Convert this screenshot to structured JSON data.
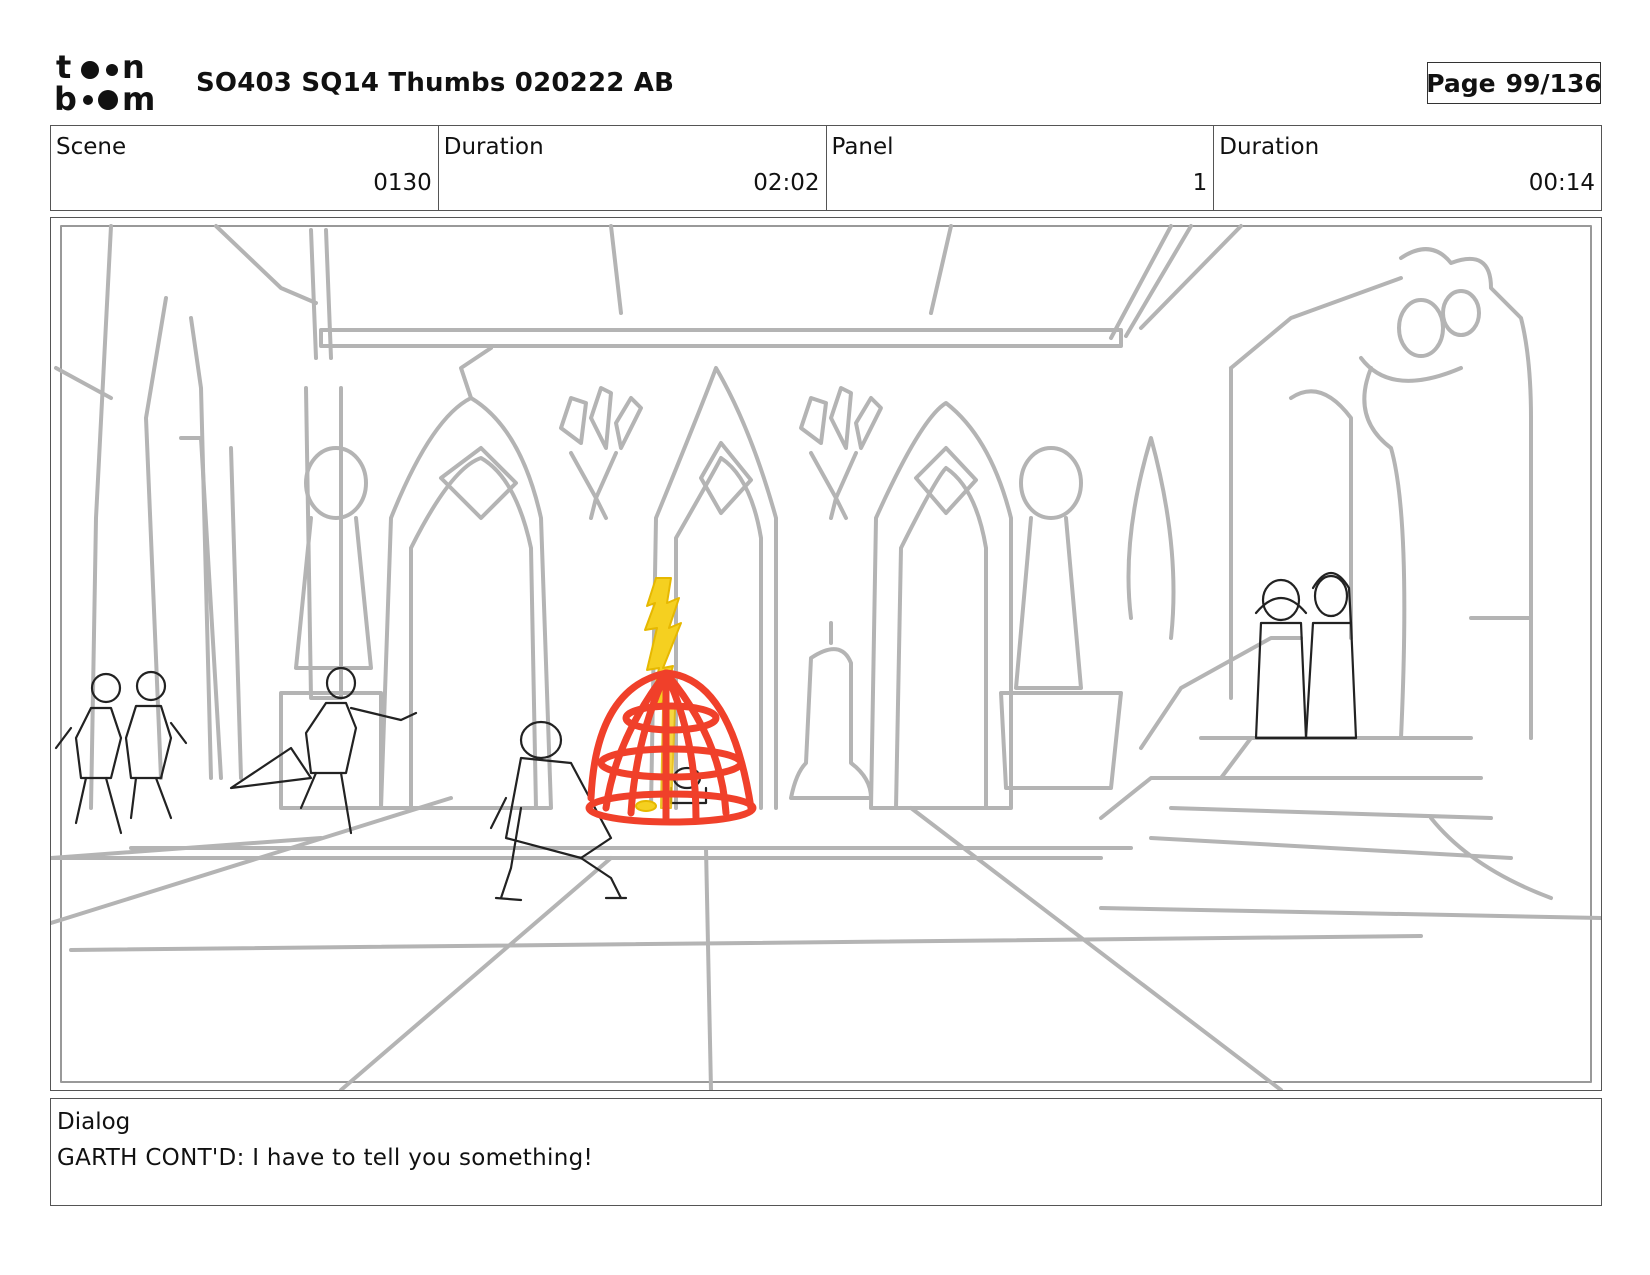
{
  "header": {
    "logo_text": "toon boom",
    "document_title": "SO403 SQ14 Thumbs 020222 AB",
    "page_label": "Page",
    "page_number": "99/136"
  },
  "info": {
    "scene_label": "Scene",
    "scene_value": "0130",
    "scene_duration_label": "Duration",
    "scene_duration_value": "02:02",
    "panel_label": "Panel",
    "panel_value": "1",
    "panel_duration_label": "Duration",
    "panel_duration_value": "00:14"
  },
  "panel": {
    "description": "",
    "accent_colors": {
      "cage": "#f0402a",
      "flame": "#f5d020",
      "sketch": "#b4b4b4",
      "ink": "#222222"
    }
  },
  "dialog": {
    "label": "Dialog",
    "text": "GARTH CONT'D: I have to tell you something!"
  }
}
